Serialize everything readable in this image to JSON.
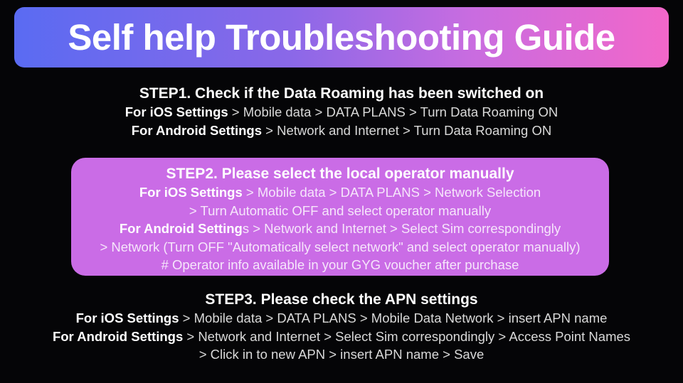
{
  "banner": {
    "title": "Self help Troubleshooting Guide",
    "gradient_from": "#5a6bf2",
    "gradient_mid": "#9a6be0",
    "gradient_to": "#f267c9"
  },
  "background_color": "#050507",
  "steps": [
    {
      "id": "step1",
      "heading": "STEP1. Check if the Data Roaming has been switched on",
      "lines": [
        {
          "bold": "For iOS Settings",
          "rest": " > Mobile data > DATA PLANS > Turn Data Roaming ON"
        },
        {
          "bold": "For Android Settings",
          "rest": " > Network and Internet > Turn Data Roaming ON"
        }
      ]
    },
    {
      "id": "step2",
      "highlight_color": "#ca6ce6",
      "heading": "STEP2. Please select the local operator manually",
      "lines": [
        {
          "bold": "For iOS Settings",
          "rest": " > Mobile data > DATA PLANS > Network Selection"
        },
        {
          "bold": "",
          "rest": "> Turn Automatic OFF and select operator manually"
        },
        {
          "bold": "For Android Setting",
          "rest": "s > Network and Internet > Select Sim correspondingly"
        },
        {
          "bold": "",
          "rest": "> Network (Turn OFF \"Automatically select network\" and select operator manually)"
        },
        {
          "bold": "",
          "rest": "# Operator info available in your GYG voucher after purchase"
        }
      ]
    },
    {
      "id": "step3",
      "heading": "STEP3. Please check the APN settings",
      "lines": [
        {
          "bold": "For iOS Settings",
          "rest": " > Mobile data > DATA PLANS > Mobile Data Network > insert APN name"
        },
        {
          "bold": "For Android Settings",
          "rest": " > Network and Internet > Select Sim correspondingly > Access Point Names"
        },
        {
          "bold": "",
          "rest": "> Click in to new APN > insert APN name > Save"
        }
      ]
    }
  ]
}
